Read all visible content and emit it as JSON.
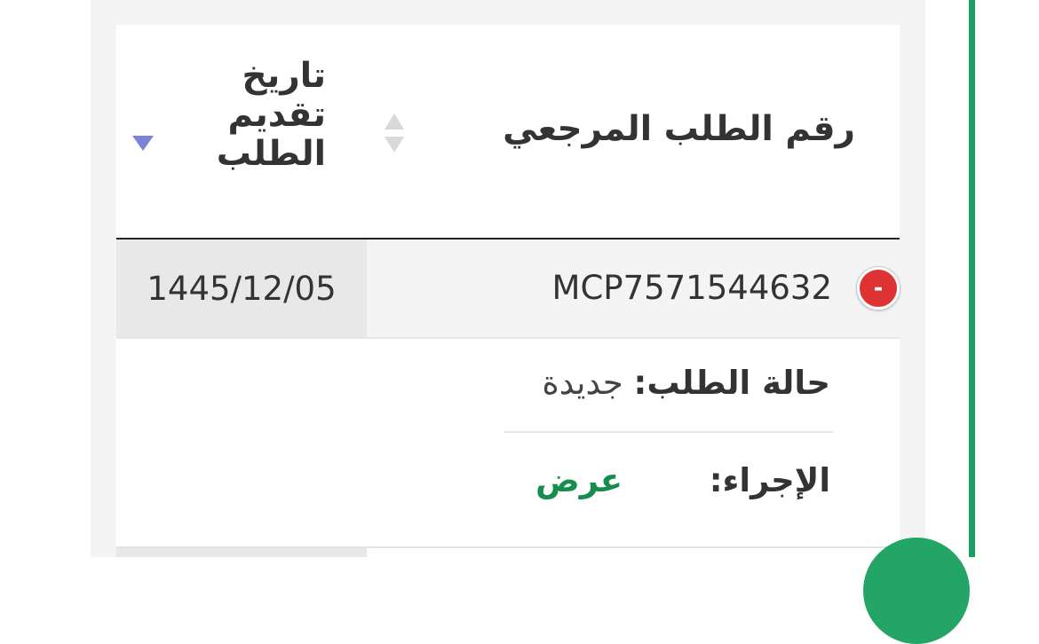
{
  "table": {
    "columns": {
      "reference_number": "رقم الطلب المرجعي",
      "submission_date_lines": [
        "تاريخ",
        "تقديم",
        "الطلب"
      ]
    },
    "rows": [
      {
        "reference_number": "MCP7571544632",
        "submission_date": "1445/12/05",
        "toggle_symbol": "-",
        "details": {
          "status_label": "حالة الطلب:",
          "status_value": "جديدة",
          "action_label": "الإجراء:",
          "action_link": "عرض"
        }
      }
    ]
  },
  "colors": {
    "accent_green": "#1a9e62",
    "link_green": "#168c4e",
    "collapse_red": "#dd3333",
    "sort_active": "#7b84d6"
  },
  "icons": {
    "sort_both": "sort-both-icon",
    "sort_desc": "sort-desc-icon",
    "collapse": "minus-circle-icon"
  }
}
